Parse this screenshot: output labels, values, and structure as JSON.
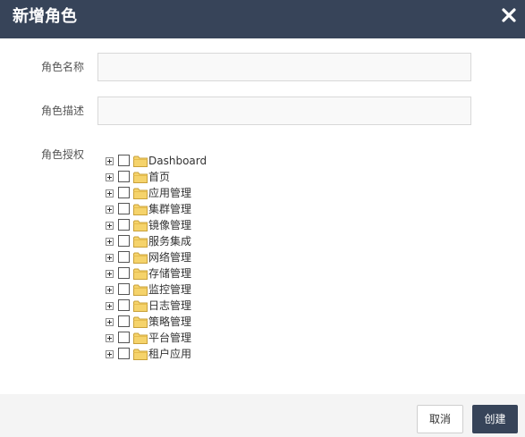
{
  "dialog": {
    "title": "新增角色",
    "close_icon": "close-icon"
  },
  "form": {
    "name_label": "角色名称",
    "name_value": "",
    "desc_label": "角色描述",
    "desc_value": "",
    "auth_label": "角色授权"
  },
  "tree": {
    "items": [
      {
        "label": "Dashboard",
        "checked": false,
        "icon": "folder-icon"
      },
      {
        "label": "首页",
        "checked": false,
        "icon": "folder-icon"
      },
      {
        "label": "应用管理",
        "checked": false,
        "icon": "folder-icon"
      },
      {
        "label": "集群管理",
        "checked": false,
        "icon": "folder-icon"
      },
      {
        "label": "镜像管理",
        "checked": false,
        "icon": "folder-icon"
      },
      {
        "label": "服务集成",
        "checked": false,
        "icon": "folder-icon"
      },
      {
        "label": "网络管理",
        "checked": false,
        "icon": "folder-icon"
      },
      {
        "label": "存储管理",
        "checked": false,
        "icon": "folder-icon"
      },
      {
        "label": "监控管理",
        "checked": false,
        "icon": "folder-icon"
      },
      {
        "label": "日志管理",
        "checked": false,
        "icon": "folder-icon"
      },
      {
        "label": "策略管理",
        "checked": false,
        "icon": "folder-icon"
      },
      {
        "label": "平台管理",
        "checked": false,
        "icon": "folder-icon"
      },
      {
        "label": "租户应用",
        "checked": false,
        "icon": "folder-icon"
      }
    ]
  },
  "footer": {
    "cancel_label": "取消",
    "create_label": "创建"
  },
  "colors": {
    "header_bg": "#374459",
    "primary_button": "#374459",
    "folder_yellow": "#f5d36b"
  }
}
